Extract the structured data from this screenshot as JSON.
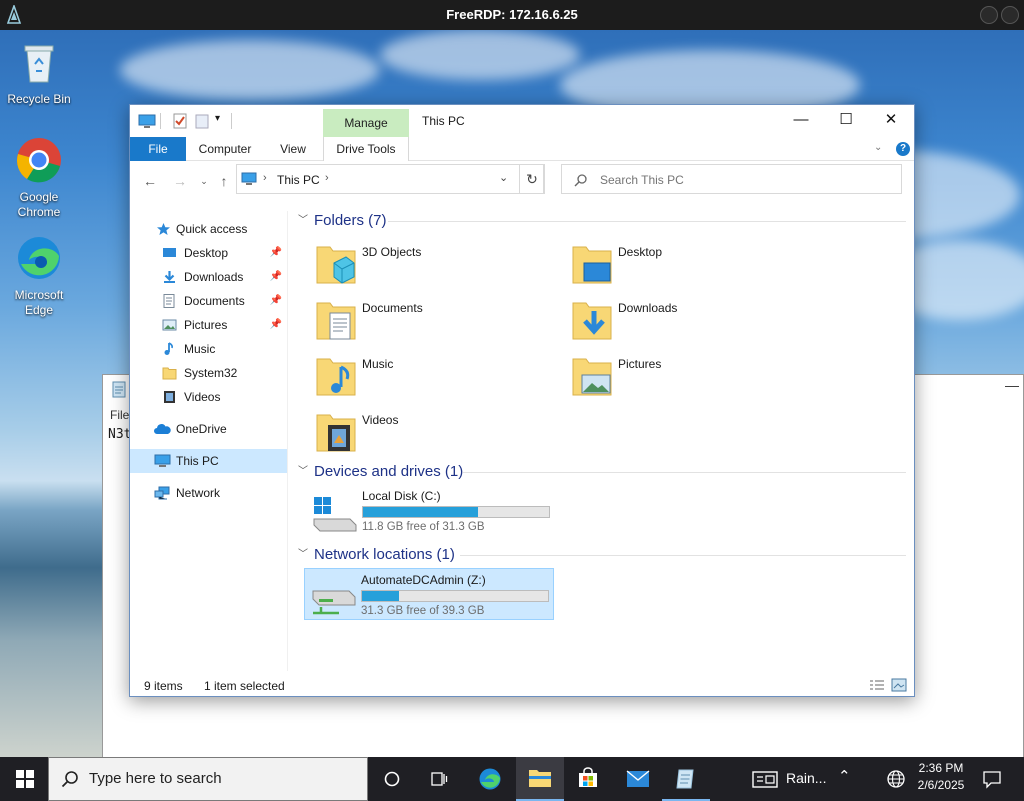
{
  "rdp": {
    "title": "FreeRDP: 172.16.6.25"
  },
  "desktop": {
    "icons": [
      {
        "label": "Recycle Bin"
      },
      {
        "label": "Google Chrome"
      },
      {
        "label": "Microsoft Edge"
      }
    ],
    "notepad": {
      "menu": "File",
      "text": "N3t"
    }
  },
  "explorer": {
    "title": "This PC",
    "manage_tab": "Manage",
    "ribbon": {
      "file": "File",
      "computer": "Computer",
      "view": "View",
      "drive_tools": "Drive Tools"
    },
    "address": "This PC",
    "search_placeholder": "Search This PC",
    "sidebar": {
      "quick_access": "Quick access",
      "items": [
        {
          "label": "Desktop",
          "pinned": true
        },
        {
          "label": "Downloads",
          "pinned": true
        },
        {
          "label": "Documents",
          "pinned": true
        },
        {
          "label": "Pictures",
          "pinned": true
        },
        {
          "label": "Music",
          "pinned": false
        },
        {
          "label": "System32",
          "pinned": false
        },
        {
          "label": "Videos",
          "pinned": false
        }
      ],
      "onedrive": "OneDrive",
      "this_pc": "This PC",
      "network": "Network"
    },
    "groups": {
      "folders": "Folders (7)",
      "devices": "Devices and drives (1)",
      "network": "Network locations (1)"
    },
    "folders": [
      {
        "name": "3D Objects"
      },
      {
        "name": "Desktop"
      },
      {
        "name": "Documents"
      },
      {
        "name": "Downloads"
      },
      {
        "name": "Music"
      },
      {
        "name": "Pictures"
      },
      {
        "name": "Videos"
      }
    ],
    "drives": [
      {
        "name": "Local Disk (C:)",
        "free": "11.8 GB free of 31.3 GB",
        "used_fraction": 0.62
      },
      {
        "name": "AutomateDCAdmin (Z:)",
        "free": "31.3 GB free of 39.3 GB",
        "used_fraction": 0.2
      }
    ],
    "status": {
      "items": "9 items",
      "selected": "1 item selected"
    }
  },
  "taskbar": {
    "search": "Type here to search",
    "weather": "Rain...",
    "time": "2:36 PM",
    "date": "2/6/2025"
  },
  "colors": {
    "accent": "#1979ca",
    "selection": "#cce8ff",
    "drive_bar": "#26a0da",
    "manage": "#c9ecc0"
  }
}
